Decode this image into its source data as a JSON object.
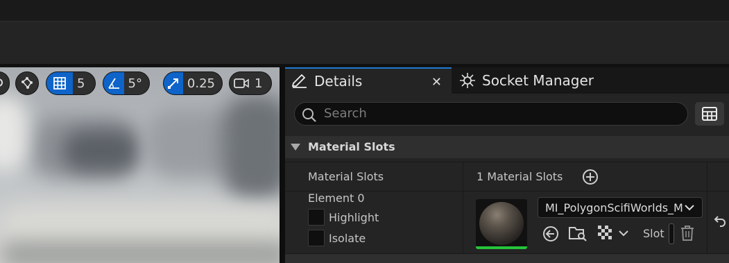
{
  "toolbar": {
    "grid_value": "5",
    "angle_value": "5°",
    "scale_value": "0.25",
    "camera_value": "1"
  },
  "tabs": {
    "details_label": "Details",
    "socket_manager_label": "Socket Manager"
  },
  "search": {
    "placeholder": "Search"
  },
  "section": {
    "title": "Material Slots"
  },
  "rows": {
    "material_slots_label": "Material Slots",
    "material_slots_count": "1 Material Slots",
    "element_label": "Element 0",
    "highlight_label": "Highlight",
    "isolate_label": "Isolate",
    "material_value": "MI_PolygonScifiWorlds_M",
    "slot_label": "Slot"
  },
  "colors": {
    "accent": "#0e64c8",
    "tab_highlight": "#1f7ad6",
    "thumbnail_bar": "#25c43a"
  }
}
